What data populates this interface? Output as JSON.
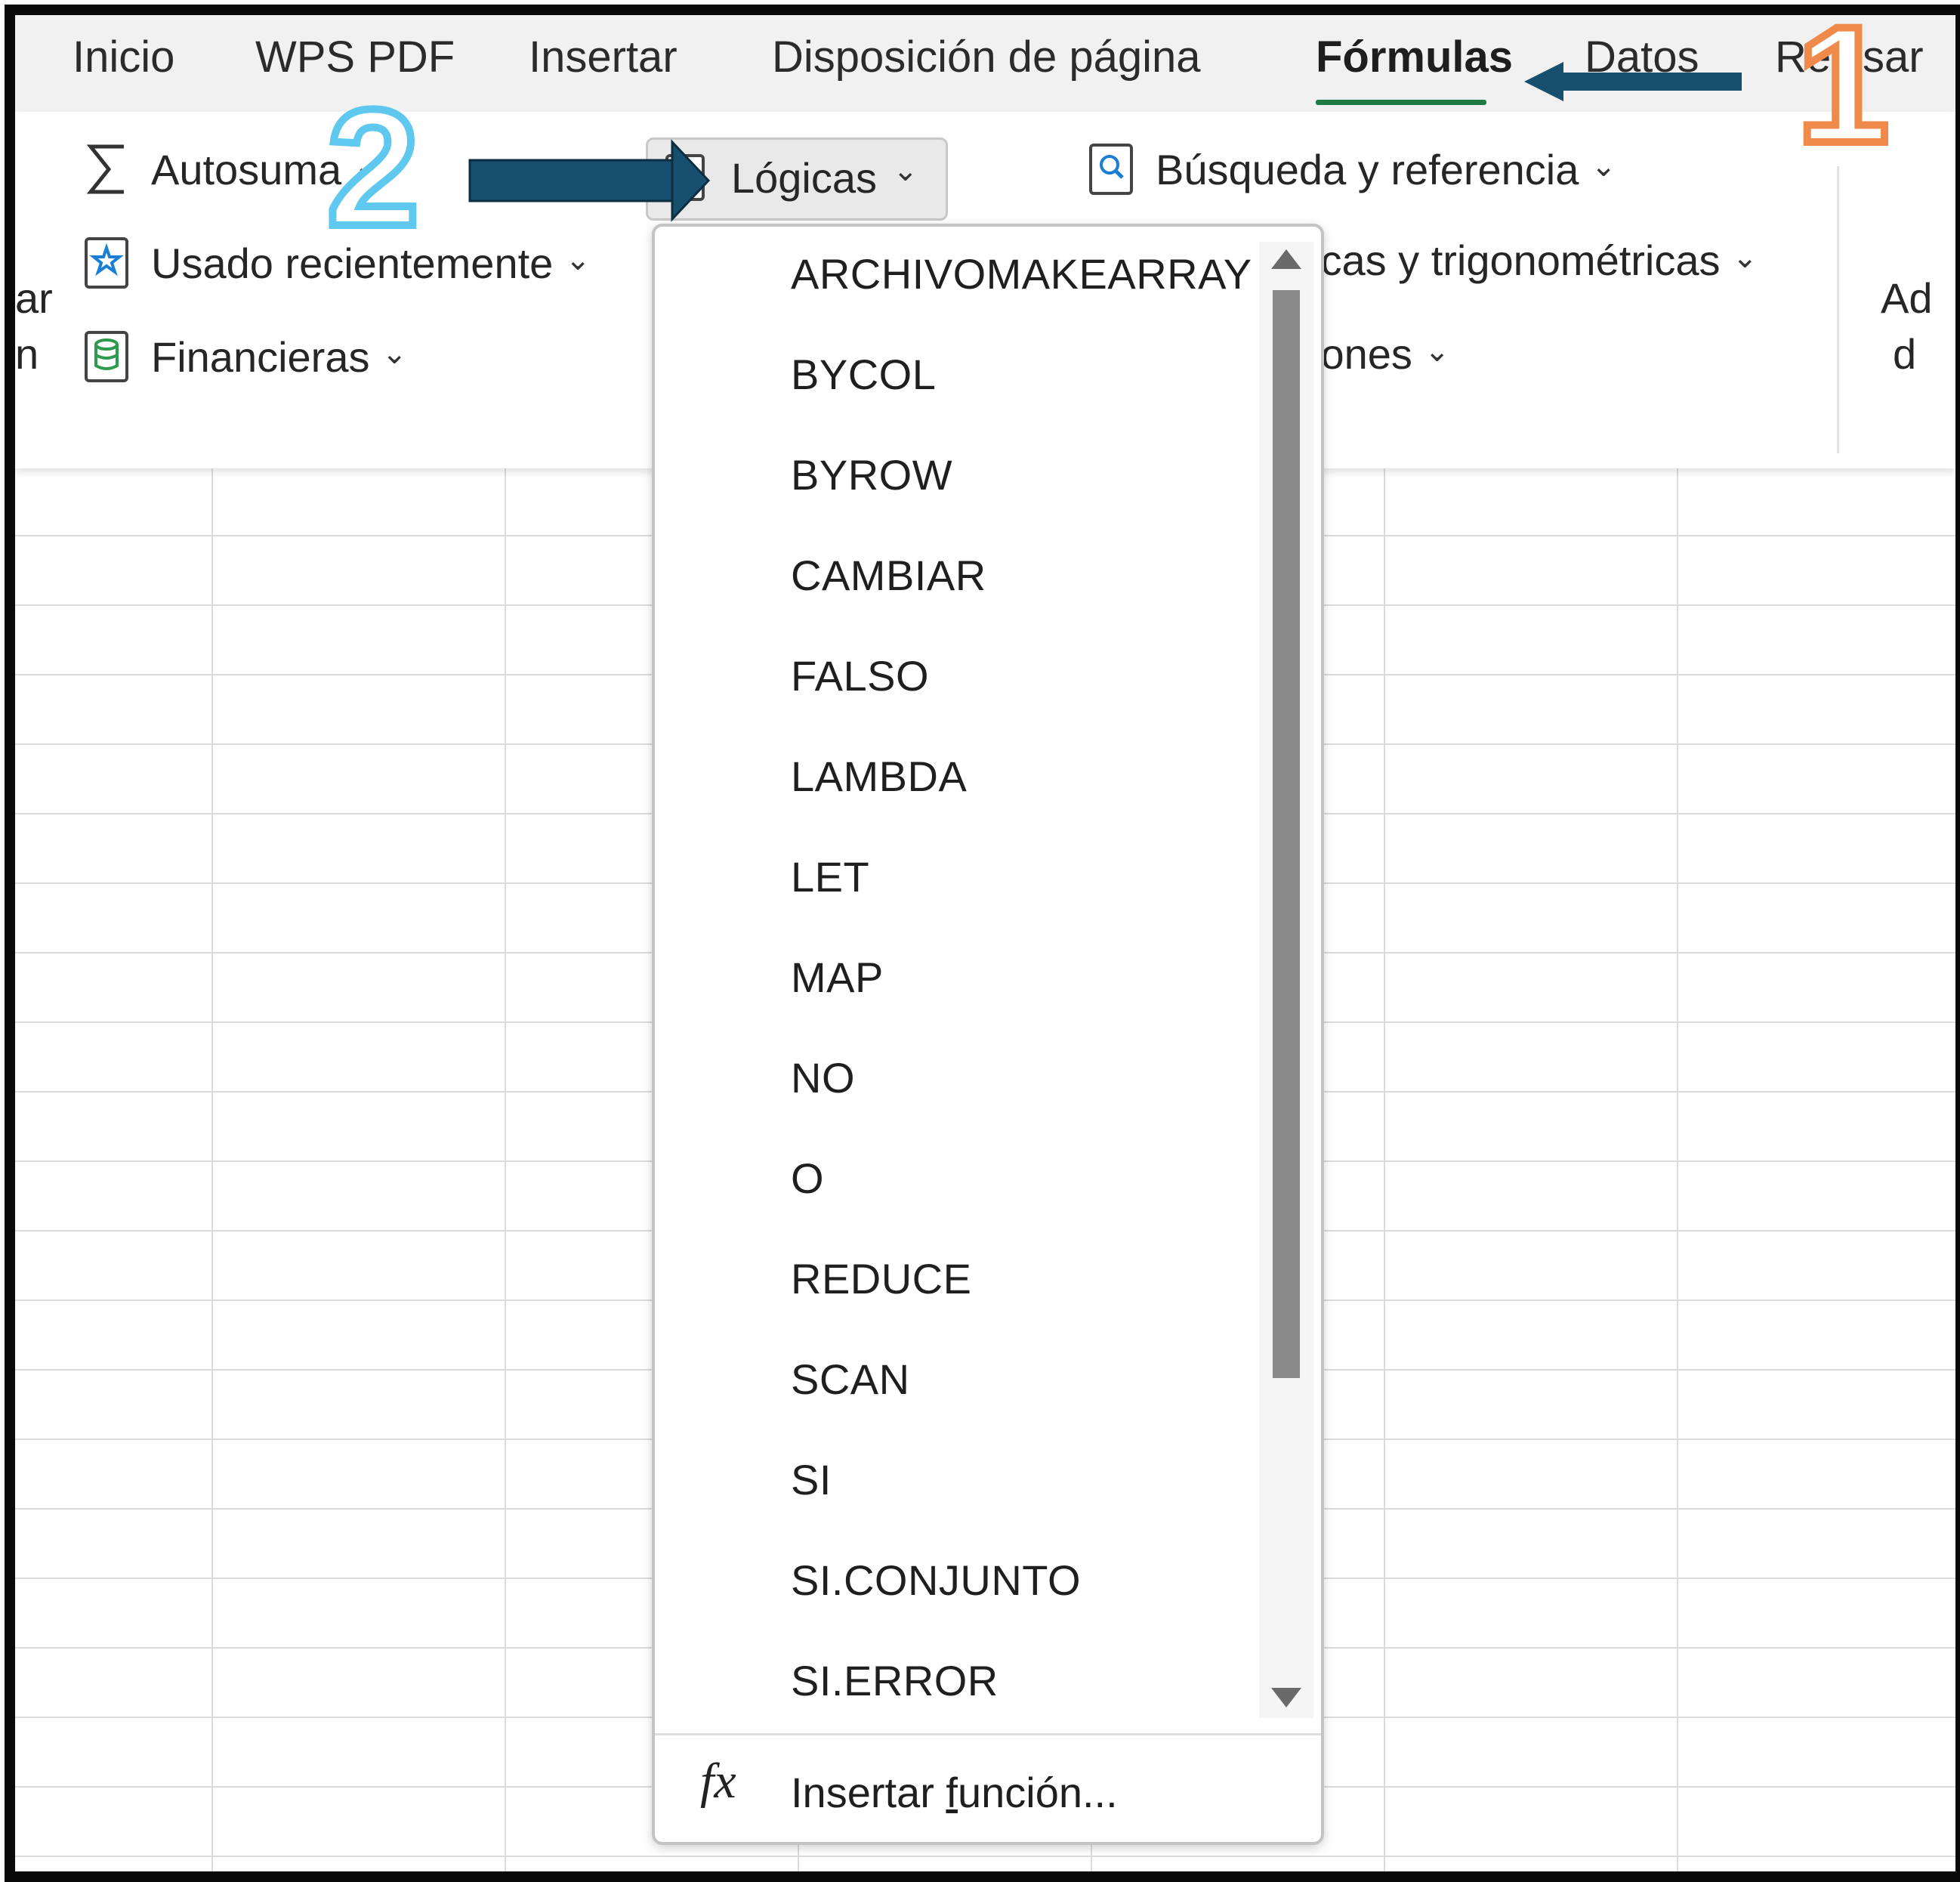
{
  "menu_tabs": [
    "Inicio",
    "WPS PDF",
    "Insertar",
    "Disposición de página",
    "Fórmulas",
    "Datos",
    "Revisar"
  ],
  "active_tab": "Fórmulas",
  "ribbon": {
    "autosuma": "Autosuma",
    "usado_recientemente": "Usado recientemente",
    "financieras": "Financieras",
    "logicas": "Lógicas",
    "busqueda": "Búsqueda y referencia",
    "matematicas_partial": "icas y trigonométricas",
    "mas_funciones_partial": "iones",
    "left_clip_1": "ar",
    "left_clip_2": "n",
    "right_clip_1": "Ad",
    "right_clip_2": "d"
  },
  "dropdown": {
    "items": [
      "ARCHIVOMAKEARRAY",
      "BYCOL",
      "BYROW",
      "CAMBIAR",
      "FALSO",
      "LAMBDA",
      "LET",
      "MAP",
      "NO",
      "O",
      "REDUCE",
      "SCAN",
      "SI",
      "SI.CONJUNTO",
      "SI.ERROR"
    ],
    "insert_function_pre": "Insertar ",
    "insert_function_underlined": "f",
    "insert_function_post": "unción...",
    "fx_symbol": "fx"
  },
  "annotations": {
    "step1": "1",
    "step2": "2",
    "step1_color": "#f08a4b",
    "step2_color": "#5ec8ee",
    "arrow_color": "#16506e"
  },
  "icons": [
    "sigma-icon",
    "star-book-icon",
    "database-book-icon",
    "logic-book-icon",
    "search-book-icon"
  ]
}
